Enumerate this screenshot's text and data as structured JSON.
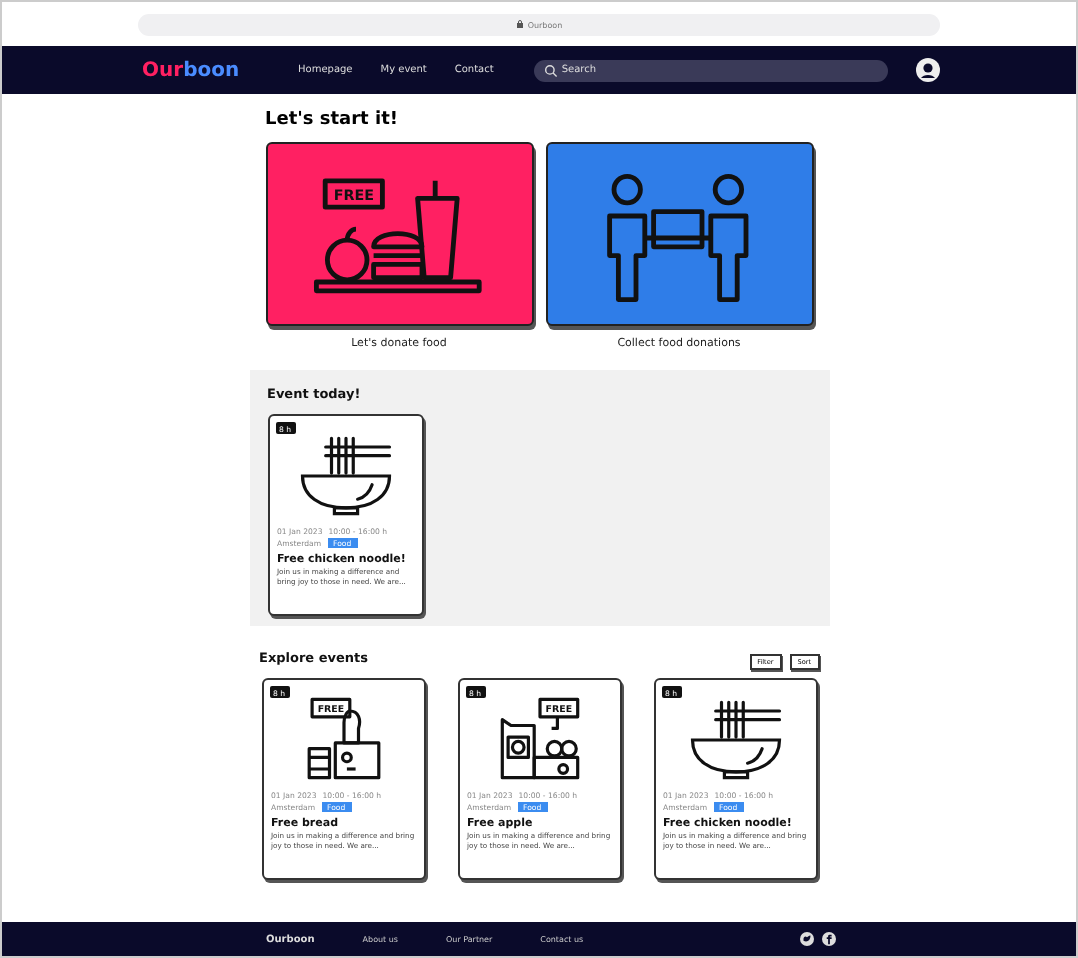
{
  "browser": {
    "address": "Ourboon"
  },
  "nav": {
    "logo_first": "Our",
    "logo_second": "boon",
    "links": [
      "Homepage",
      "My event",
      "Contact"
    ],
    "search": {
      "placeholder": "Search"
    }
  },
  "hero": {
    "title": "Let's start it!",
    "actions": [
      {
        "kind": "donate",
        "sign": "FREE",
        "label": "Let's donate food",
        "color": "#ff2062"
      },
      {
        "kind": "collect",
        "label": "Collect food donations",
        "color": "#2f7de8"
      }
    ]
  },
  "today": {
    "title": "Event today!",
    "events": [
      {
        "kind": "noodle",
        "badge": "8 h",
        "date": "01 Jan 2023",
        "time": "10:00 - 16:00 h",
        "place": "Amsterdam",
        "tag": "Food",
        "title": "Free chicken noodle!",
        "text": "Join us in making a difference and bring joy to those in need. We are..."
      }
    ]
  },
  "explore": {
    "title": "Explore events",
    "buttons": [
      "Filter",
      "Sort"
    ],
    "events": [
      {
        "kind": "bread",
        "sign": "FREE",
        "badge": "8 h",
        "date": "01 Jan 2023",
        "time": "10:00 - 16:00 h",
        "place": "Amsterdam",
        "tag": "Food",
        "title": "Free bread",
        "text": "Join us in making a difference and bring joy to those in need. We are..."
      },
      {
        "kind": "apple",
        "sign": "FREE",
        "badge": "8 h",
        "date": "01 Jan 2023",
        "time": "10:00 - 16:00 h",
        "place": "Amsterdam",
        "tag": "Food",
        "title": "Free apple",
        "text": "Join us in making a difference and bring joy to those in need. We are..."
      },
      {
        "kind": "noodle",
        "badge": "8 h",
        "date": "01 Jan 2023",
        "time": "10:00 - 16:00 h",
        "place": "Amsterdam",
        "tag": "Food",
        "title": "Free chicken noodle!",
        "text": "Join us in making a difference and bring joy to those in need. We are..."
      }
    ]
  },
  "footer": {
    "brand": "Ourboon",
    "links": [
      "About us",
      "Our Partner",
      "Contact us"
    ]
  }
}
